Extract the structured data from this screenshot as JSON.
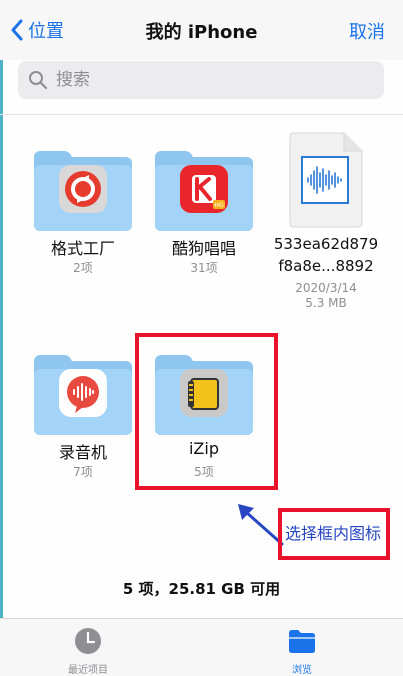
{
  "nav": {
    "back_label": "位置",
    "title": "我的 iPhone",
    "cancel_label": "取消"
  },
  "search": {
    "placeholder": "搜索"
  },
  "items": [
    {
      "name": "格式工厂",
      "sub": "2项",
      "kind": "folder",
      "icon": "format-factory-icon"
    },
    {
      "name": "酷狗唱唱",
      "sub": "31项",
      "kind": "folder",
      "icon": "kugou-changchang-icon"
    },
    {
      "name": "533ea62d879\nf8a8e...8892",
      "name_line1": "533ea62d879",
      "name_line2": "f8a8e...8892",
      "date": "2020/3/14",
      "size": "5.3 MB",
      "kind": "audio-file",
      "icon": "audio-file-icon"
    },
    {
      "name": "录音机",
      "sub": "7项",
      "kind": "folder",
      "icon": "recorder-icon"
    },
    {
      "name": "iZip",
      "sub": "5项",
      "kind": "folder",
      "icon": "izip-icon"
    }
  ],
  "storage_info": "5 项，25.81 GB 可用",
  "annotation": {
    "text": "选择框内图标",
    "color": "#e8132b",
    "text_color": "#2746c4"
  },
  "tabbar": {
    "recent_label": "最近项目",
    "browse_label": "浏览",
    "active": "browse"
  },
  "colors": {
    "accent": "#1a73e8",
    "folder": "#a3d3f6"
  }
}
